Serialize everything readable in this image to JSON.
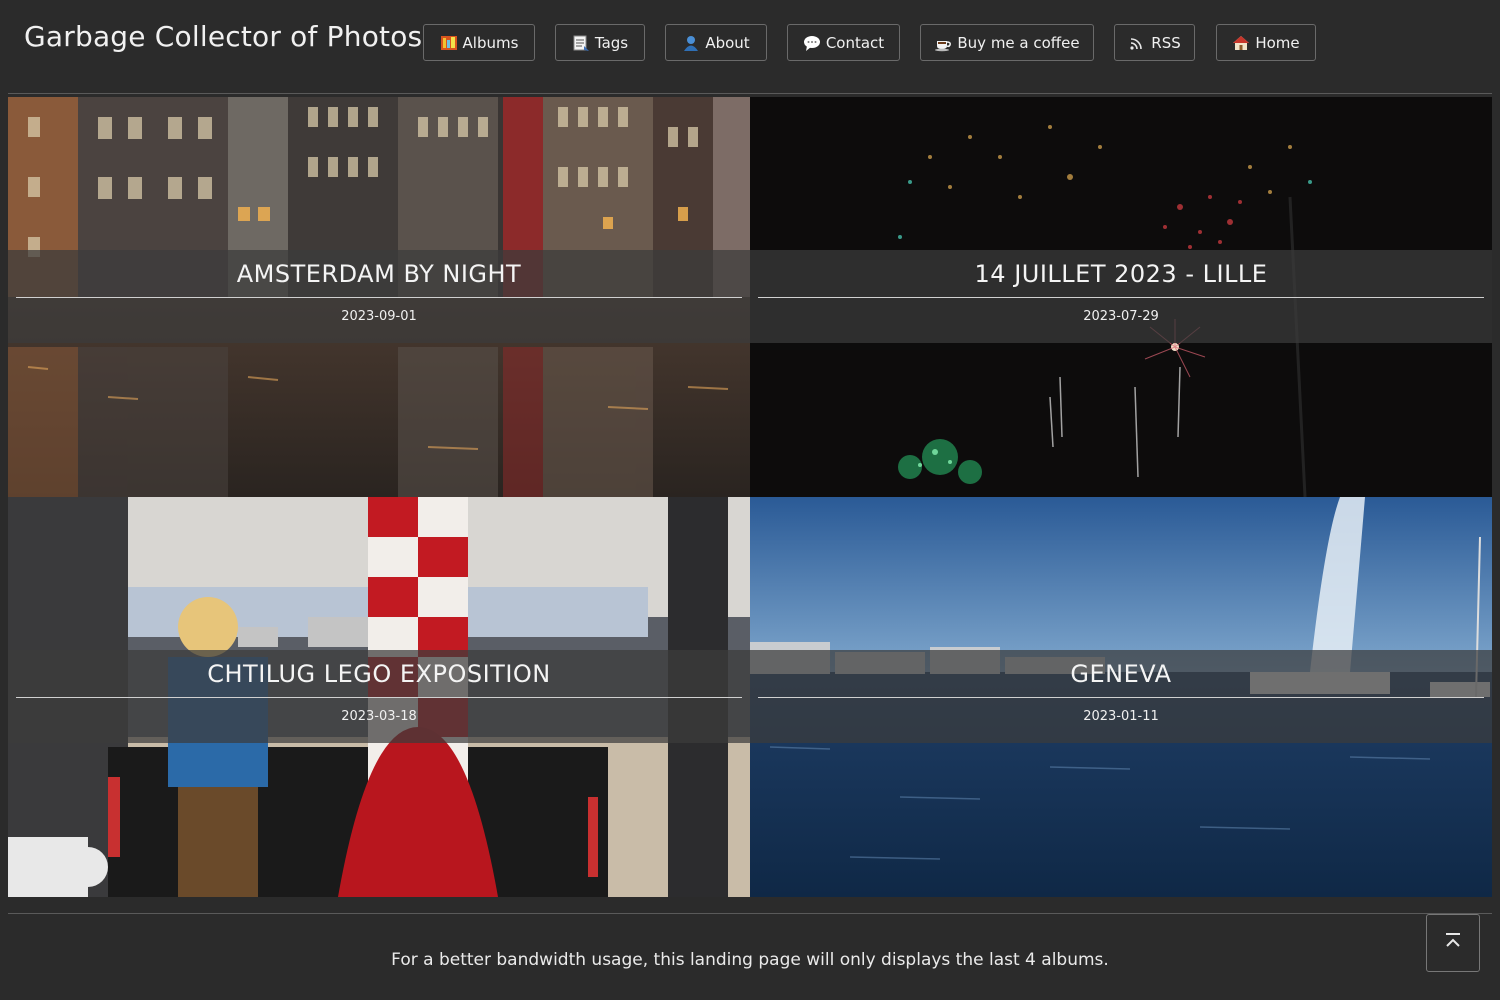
{
  "site": {
    "title": "Garbage Collector of Photos"
  },
  "nav": [
    {
      "label": "Albums",
      "icon": "albums-icon"
    },
    {
      "label": "Tags",
      "icon": "tags-icon"
    },
    {
      "label": "About",
      "icon": "user-icon"
    },
    {
      "label": "Contact",
      "icon": "speech-bubble-icon"
    },
    {
      "label": "Buy me a coffee",
      "icon": "coffee-icon"
    },
    {
      "label": "RSS",
      "icon": "rss-icon"
    },
    {
      "label": "Home",
      "icon": "house-icon"
    }
  ],
  "albums": [
    {
      "title": "AMSTERDAM BY NIGHT",
      "date": "2023-09-01"
    },
    {
      "title": "14 JUILLET 2023 - LILLE",
      "date": "2023-07-29"
    },
    {
      "title": "CHTILUG LEGO EXPOSITION",
      "date": "2023-03-18"
    },
    {
      "title": "GENEVA",
      "date": "2023-01-11"
    }
  ],
  "footer": {
    "note": "For a better bandwidth usage, this landing page will only displays the last 4 albums."
  },
  "scroll_top": {
    "icon": "arrow-up-to-top-icon"
  },
  "colors": {
    "background": "#2b2b2b",
    "text": "#f0f0f0",
    "border": "#6a6a6a"
  }
}
